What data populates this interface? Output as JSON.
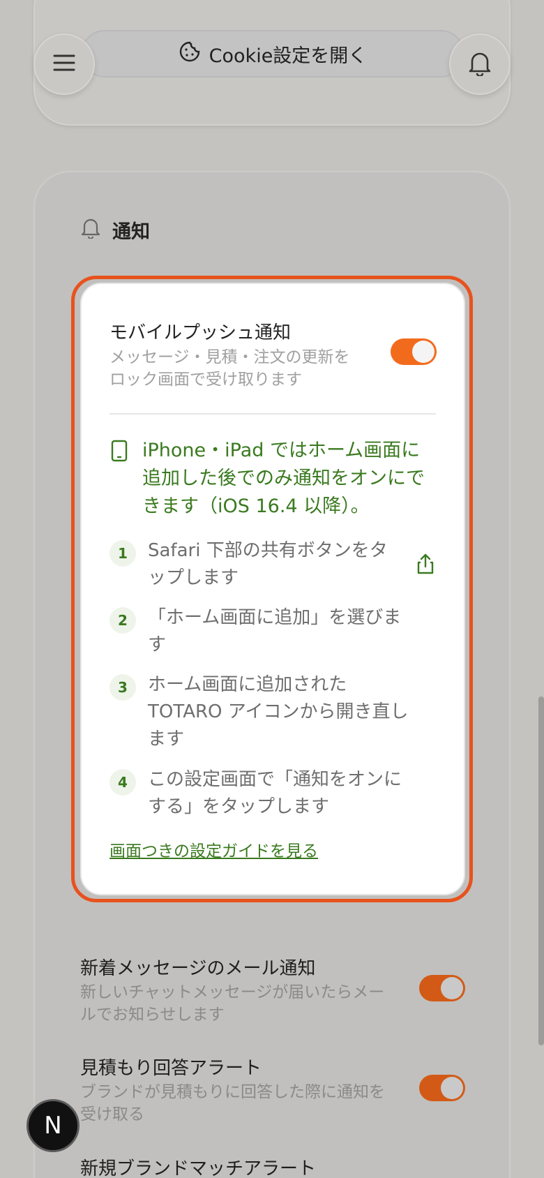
{
  "header": {
    "cookie_button_label": "Cookie設定を開く"
  },
  "notifications": {
    "section_title": "通知",
    "push": {
      "title": "モバイルプッシュ通知",
      "desc_line1": "メッセージ・見積・注文の更新を",
      "desc_line2": "ロック画面で受け取ります",
      "enabled": true
    },
    "ios_note": {
      "line1": "iPhone・iPad ではホーム画面に",
      "line2": "追加した後でのみ通知をオンにで",
      "line3": "きます（iOS 16.4 以降）。"
    },
    "steps": [
      {
        "num": "1",
        "line1": "Safari 下部の共有ボタンをタ",
        "line2": "ップします"
      },
      {
        "num": "2",
        "line1": "「ホーム画面に追加」を選びま",
        "line2": "す"
      },
      {
        "num": "3",
        "line1": "ホーム画面に追加された",
        "line2": "TOTARO アイコンから開き直し",
        "line3": "ます"
      },
      {
        "num": "4",
        "line1": "この設定画面で「通知をオンに",
        "line2": "する」をタップします"
      }
    ],
    "guide_link": "画面つきの設定ガイドを見る"
  },
  "settings": [
    {
      "title": "新着メッセージのメール通知",
      "desc_line1": "新しいチャットメッセージが届いたらメー",
      "desc_line2": "ルでお知らせします",
      "enabled": true
    },
    {
      "title": "見積もり回答アラート",
      "desc_line1": "ブランドが見積もりに回答した際に通知を",
      "desc_line2": "受け取る",
      "enabled": true
    },
    {
      "title": "新規ブランドマッチアラート",
      "enabled": true
    }
  ],
  "badge": {
    "letter": "N"
  },
  "colors": {
    "accent": "#f26b1d",
    "highlight_border": "#e8521c",
    "green": "#3a7a1f"
  }
}
